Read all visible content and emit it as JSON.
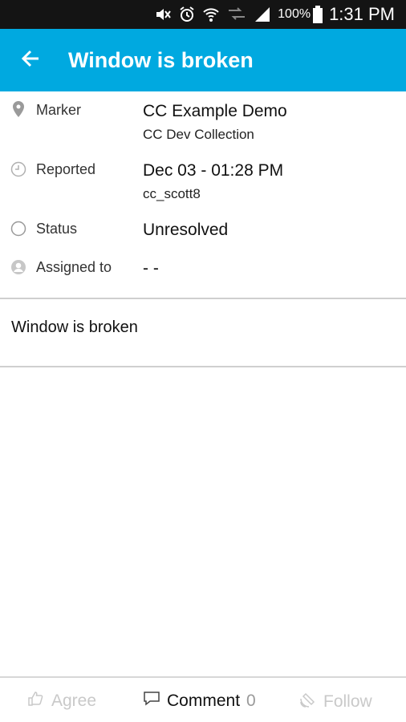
{
  "status_bar": {
    "battery": "100%",
    "time": "1:31 PM",
    "icons": [
      "mute-icon",
      "alarm-icon",
      "wifi-icon",
      "data-icon",
      "signal-icon",
      "battery-icon"
    ]
  },
  "app_bar": {
    "title": "Window is broken",
    "back_icon": "arrow-left-icon",
    "color": "#00a9e0"
  },
  "details": {
    "marker": {
      "label": "Marker",
      "value": "CC Example Demo",
      "sub": "CC Dev Collection",
      "icon": "map-pin-icon"
    },
    "reported": {
      "label": "Reported",
      "value": "Dec 03 - 01:28 PM",
      "sub": "cc_scott8",
      "icon": "clock-icon"
    },
    "status": {
      "label": "Status",
      "value": "Unresolved",
      "icon": "circle-icon"
    },
    "assigned": {
      "label": "Assigned to",
      "value": "- -",
      "icon": "person-icon"
    }
  },
  "description": "Window is broken",
  "bottom_bar": {
    "agree": {
      "label": "Agree",
      "icon": "thumbs-up-icon"
    },
    "comment": {
      "label": "Comment",
      "count": "0",
      "icon": "speech-bubble-icon"
    },
    "follow": {
      "label": "Follow",
      "icon": "satellite-icon"
    }
  }
}
